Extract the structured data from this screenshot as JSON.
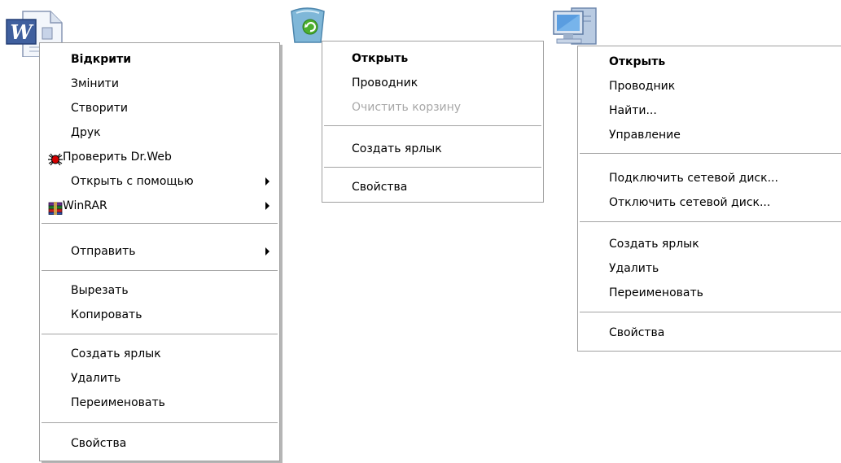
{
  "menus": {
    "word": {
      "items": [
        {
          "label": "Відкрити"
        },
        {
          "label": "Змінити"
        },
        {
          "label": "Створити"
        },
        {
          "label": "Друк"
        },
        {
          "label": "Проверить Dr.Web",
          "icon": "spider-icon"
        },
        {
          "label": "Открыть с помощью"
        },
        {
          "label": "WinRAR",
          "icon": "winrar-icon"
        },
        {
          "label": "Отправить"
        },
        {
          "label": "Вырезать"
        },
        {
          "label": "Копировать"
        },
        {
          "label": "Создать ярлык"
        },
        {
          "label": "Удалить"
        },
        {
          "label": "Переименовать"
        },
        {
          "label": "Свойства"
        }
      ]
    },
    "bin": {
      "items": [
        {
          "label": "Открыть"
        },
        {
          "label": "Проводник"
        },
        {
          "label": "Очистить корзину",
          "disabled": true
        },
        {
          "label": "Создать ярлык"
        },
        {
          "label": "Свойства"
        }
      ]
    },
    "pc": {
      "items": [
        {
          "label": "Открыть"
        },
        {
          "label": "Проводник"
        },
        {
          "label": "Найти..."
        },
        {
          "label": "Управление"
        },
        {
          "label": "Подключить сетевой диск..."
        },
        {
          "label": "Отключить сетевой диск..."
        },
        {
          "label": "Создать ярлык"
        },
        {
          "label": "Удалить"
        },
        {
          "label": "Переименовать"
        },
        {
          "label": "Свойства"
        }
      ]
    }
  },
  "icons": {
    "word": "word-document-icon",
    "bin": "recycle-bin-icon",
    "pc": "my-computer-icon"
  },
  "colors": {
    "menu_background": "#ffffff",
    "menu_border": "#a0a0a0",
    "disabled_text": "#a8a8a8"
  }
}
